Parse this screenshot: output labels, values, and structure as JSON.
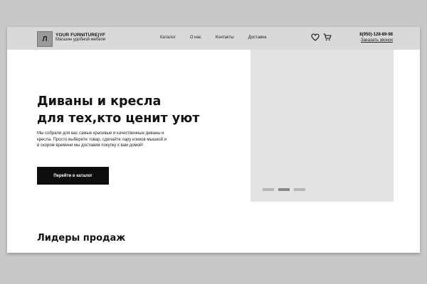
{
  "header": {
    "logo_letter": "Л",
    "brand_title": "YOUR FURNITURE|YF",
    "brand_subtitle": "Магазин удобной мебели",
    "nav": [
      "Каталог",
      "О нас",
      "Контакты",
      "Доставка"
    ],
    "icons": [
      "heart-icon",
      "cart-icon"
    ],
    "phone": "8(950)-128-89-98",
    "callback": "Заказать звонок"
  },
  "hero": {
    "title_line1": "Диваны и кресла",
    "title_line2": "для тех,кто ценит уют",
    "description": "Мы собрали для вас самые красивые и качественные диваны и кресла. Просто выберите товар, сделайте пару кликов мышкой и в скором времени мы доставим покупку к вам домой!",
    "button_label": "Перейти в каталог"
  },
  "slider": {
    "slide_count": 3,
    "active_slide": 2
  },
  "sections": {
    "bestsellers_title": "Лидеры продаж"
  },
  "colors": {
    "page_background": "#c8c8c8",
    "header_background": "#d9d9d9",
    "button_background": "#0d0d0d",
    "slider_background": "#e3e3e3"
  }
}
